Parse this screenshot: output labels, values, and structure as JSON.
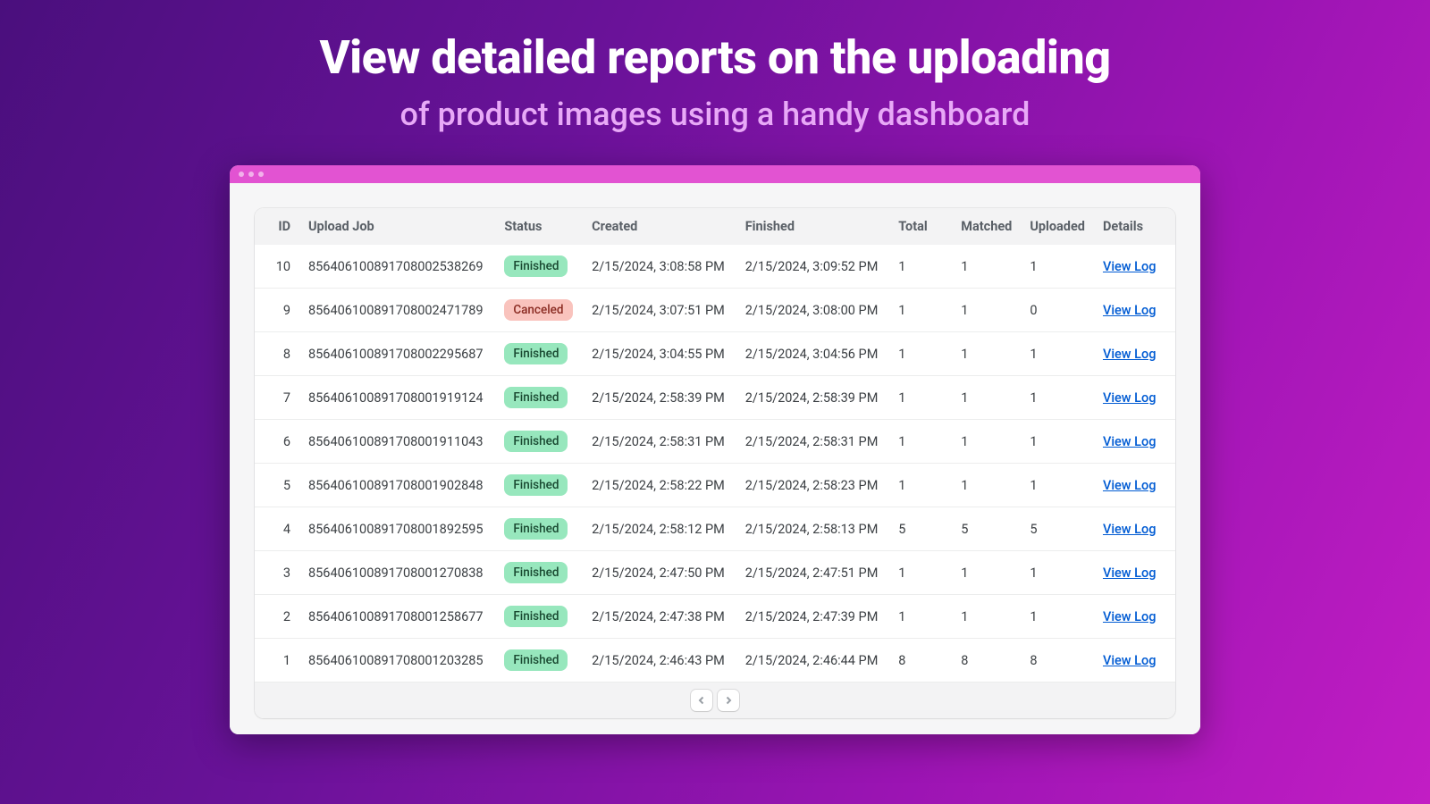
{
  "headline": {
    "title": "View detailed reports on the uploading",
    "subtitle": "of product images using a handy dashboard"
  },
  "table": {
    "headers": {
      "id": "ID",
      "upload_job": "Upload Job",
      "status": "Status",
      "created": "Created",
      "finished": "Finished",
      "total": "Total",
      "matched": "Matched",
      "uploaded": "Uploaded",
      "details": "Details"
    },
    "view_log_label": "View Log",
    "status_labels": {
      "finished": "Finished",
      "canceled": "Canceled"
    },
    "rows": [
      {
        "id": "10",
        "upload_job": "856406100891708002538269",
        "status": "finished",
        "created": "2/15/2024, 3:08:58 PM",
        "finished": "2/15/2024, 3:09:52 PM",
        "total": "1",
        "matched": "1",
        "uploaded": "1"
      },
      {
        "id": "9",
        "upload_job": "856406100891708002471789",
        "status": "canceled",
        "created": "2/15/2024, 3:07:51 PM",
        "finished": "2/15/2024, 3:08:00 PM",
        "total": "1",
        "matched": "1",
        "uploaded": "0"
      },
      {
        "id": "8",
        "upload_job": "856406100891708002295687",
        "status": "finished",
        "created": "2/15/2024, 3:04:55 PM",
        "finished": "2/15/2024, 3:04:56 PM",
        "total": "1",
        "matched": "1",
        "uploaded": "1"
      },
      {
        "id": "7",
        "upload_job": "856406100891708001919124",
        "status": "finished",
        "created": "2/15/2024, 2:58:39 PM",
        "finished": "2/15/2024, 2:58:39 PM",
        "total": "1",
        "matched": "1",
        "uploaded": "1"
      },
      {
        "id": "6",
        "upload_job": "856406100891708001911043",
        "status": "finished",
        "created": "2/15/2024, 2:58:31 PM",
        "finished": "2/15/2024, 2:58:31 PM",
        "total": "1",
        "matched": "1",
        "uploaded": "1"
      },
      {
        "id": "5",
        "upload_job": "856406100891708001902848",
        "status": "finished",
        "created": "2/15/2024, 2:58:22 PM",
        "finished": "2/15/2024, 2:58:23 PM",
        "total": "1",
        "matched": "1",
        "uploaded": "1"
      },
      {
        "id": "4",
        "upload_job": "856406100891708001892595",
        "status": "finished",
        "created": "2/15/2024, 2:58:12 PM",
        "finished": "2/15/2024, 2:58:13 PM",
        "total": "5",
        "matched": "5",
        "uploaded": "5"
      },
      {
        "id": "3",
        "upload_job": "856406100891708001270838",
        "status": "finished",
        "created": "2/15/2024, 2:47:50 PM",
        "finished": "2/15/2024, 2:47:51 PM",
        "total": "1",
        "matched": "1",
        "uploaded": "1"
      },
      {
        "id": "2",
        "upload_job": "856406100891708001258677",
        "status": "finished",
        "created": "2/15/2024, 2:47:38 PM",
        "finished": "2/15/2024, 2:47:39 PM",
        "total": "1",
        "matched": "1",
        "uploaded": "1"
      },
      {
        "id": "1",
        "upload_job": "856406100891708001203285",
        "status": "finished",
        "created": "2/15/2024, 2:46:43 PM",
        "finished": "2/15/2024, 2:46:44 PM",
        "total": "8",
        "matched": "8",
        "uploaded": "8"
      }
    ]
  }
}
